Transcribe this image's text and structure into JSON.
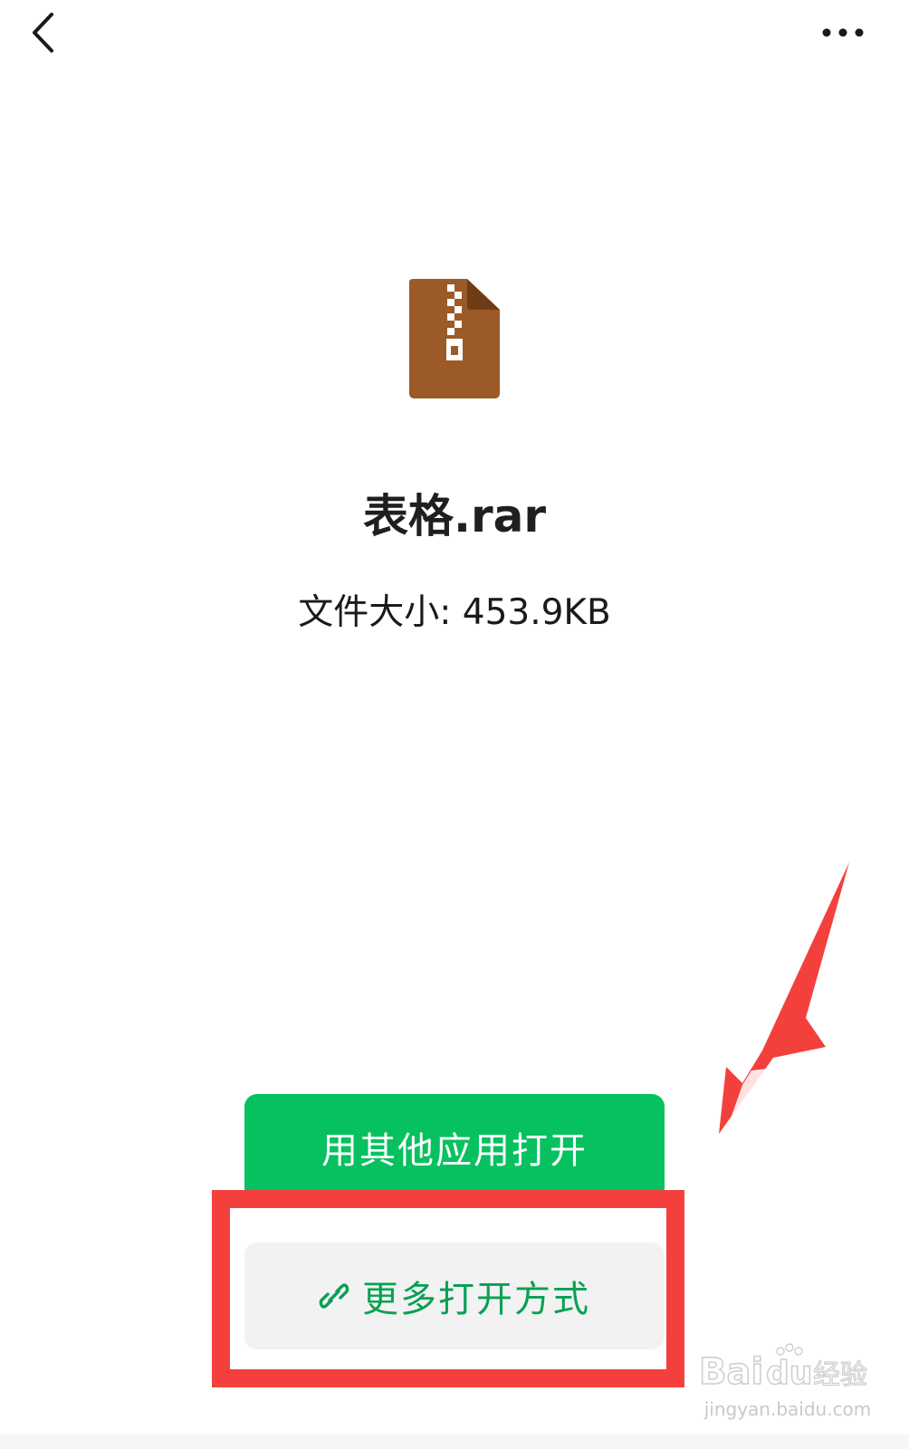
{
  "topbar": {
    "back_icon": "chevron-left-icon",
    "more_icon": "ellipsis-icon"
  },
  "file": {
    "icon": "zip-archive-icon",
    "icon_color": "#9c5a28",
    "name": "表格.rar",
    "size_text": "文件大小: 453.9KB"
  },
  "actions": {
    "open_with_other_app": "用其他应用打开",
    "more_open_methods": "更多打开方式",
    "more_open_icon": "link-icon",
    "primary_color": "#07c160",
    "secondary_text_color": "#07a152"
  },
  "annotation": {
    "highlight_color": "#f4403d"
  },
  "watermark": {
    "logo_text": "Baidu经验",
    "site": "jingyan.baidu.com"
  }
}
